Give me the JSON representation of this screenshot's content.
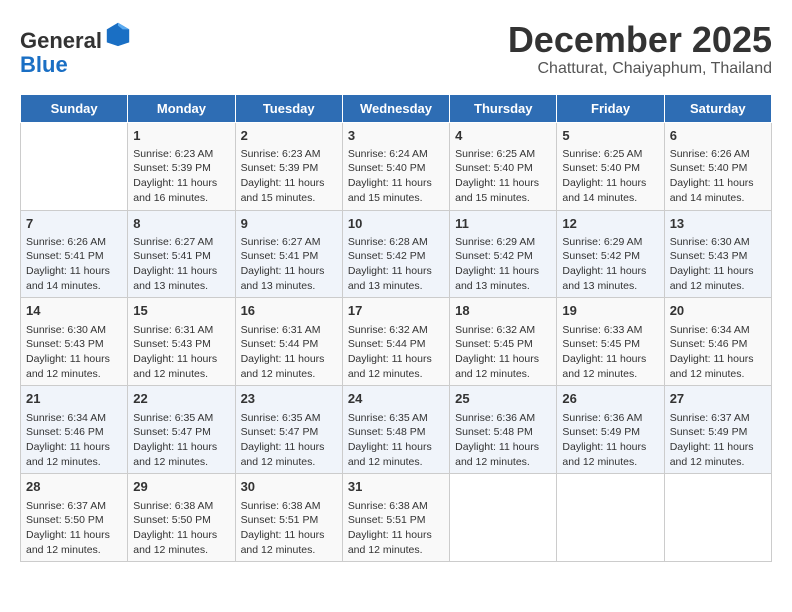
{
  "header": {
    "logo_line1": "General",
    "logo_line2": "Blue",
    "month": "December 2025",
    "location": "Chatturat, Chaiyaphum, Thailand"
  },
  "days_of_week": [
    "Sunday",
    "Monday",
    "Tuesday",
    "Wednesday",
    "Thursday",
    "Friday",
    "Saturday"
  ],
  "weeks": [
    [
      {
        "day": "",
        "info": ""
      },
      {
        "day": "1",
        "info": "Sunrise: 6:23 AM\nSunset: 5:39 PM\nDaylight: 11 hours\nand 16 minutes."
      },
      {
        "day": "2",
        "info": "Sunrise: 6:23 AM\nSunset: 5:39 PM\nDaylight: 11 hours\nand 15 minutes."
      },
      {
        "day": "3",
        "info": "Sunrise: 6:24 AM\nSunset: 5:40 PM\nDaylight: 11 hours\nand 15 minutes."
      },
      {
        "day": "4",
        "info": "Sunrise: 6:25 AM\nSunset: 5:40 PM\nDaylight: 11 hours\nand 15 minutes."
      },
      {
        "day": "5",
        "info": "Sunrise: 6:25 AM\nSunset: 5:40 PM\nDaylight: 11 hours\nand 14 minutes."
      },
      {
        "day": "6",
        "info": "Sunrise: 6:26 AM\nSunset: 5:40 PM\nDaylight: 11 hours\nand 14 minutes."
      }
    ],
    [
      {
        "day": "7",
        "info": "Sunrise: 6:26 AM\nSunset: 5:41 PM\nDaylight: 11 hours\nand 14 minutes."
      },
      {
        "day": "8",
        "info": "Sunrise: 6:27 AM\nSunset: 5:41 PM\nDaylight: 11 hours\nand 13 minutes."
      },
      {
        "day": "9",
        "info": "Sunrise: 6:27 AM\nSunset: 5:41 PM\nDaylight: 11 hours\nand 13 minutes."
      },
      {
        "day": "10",
        "info": "Sunrise: 6:28 AM\nSunset: 5:42 PM\nDaylight: 11 hours\nand 13 minutes."
      },
      {
        "day": "11",
        "info": "Sunrise: 6:29 AM\nSunset: 5:42 PM\nDaylight: 11 hours\nand 13 minutes."
      },
      {
        "day": "12",
        "info": "Sunrise: 6:29 AM\nSunset: 5:42 PM\nDaylight: 11 hours\nand 13 minutes."
      },
      {
        "day": "13",
        "info": "Sunrise: 6:30 AM\nSunset: 5:43 PM\nDaylight: 11 hours\nand 12 minutes."
      }
    ],
    [
      {
        "day": "14",
        "info": "Sunrise: 6:30 AM\nSunset: 5:43 PM\nDaylight: 11 hours\nand 12 minutes."
      },
      {
        "day": "15",
        "info": "Sunrise: 6:31 AM\nSunset: 5:43 PM\nDaylight: 11 hours\nand 12 minutes."
      },
      {
        "day": "16",
        "info": "Sunrise: 6:31 AM\nSunset: 5:44 PM\nDaylight: 11 hours\nand 12 minutes."
      },
      {
        "day": "17",
        "info": "Sunrise: 6:32 AM\nSunset: 5:44 PM\nDaylight: 11 hours\nand 12 minutes."
      },
      {
        "day": "18",
        "info": "Sunrise: 6:32 AM\nSunset: 5:45 PM\nDaylight: 11 hours\nand 12 minutes."
      },
      {
        "day": "19",
        "info": "Sunrise: 6:33 AM\nSunset: 5:45 PM\nDaylight: 11 hours\nand 12 minutes."
      },
      {
        "day": "20",
        "info": "Sunrise: 6:34 AM\nSunset: 5:46 PM\nDaylight: 11 hours\nand 12 minutes."
      }
    ],
    [
      {
        "day": "21",
        "info": "Sunrise: 6:34 AM\nSunset: 5:46 PM\nDaylight: 11 hours\nand 12 minutes."
      },
      {
        "day": "22",
        "info": "Sunrise: 6:35 AM\nSunset: 5:47 PM\nDaylight: 11 hours\nand 12 minutes."
      },
      {
        "day": "23",
        "info": "Sunrise: 6:35 AM\nSunset: 5:47 PM\nDaylight: 11 hours\nand 12 minutes."
      },
      {
        "day": "24",
        "info": "Sunrise: 6:35 AM\nSunset: 5:48 PM\nDaylight: 11 hours\nand 12 minutes."
      },
      {
        "day": "25",
        "info": "Sunrise: 6:36 AM\nSunset: 5:48 PM\nDaylight: 11 hours\nand 12 minutes."
      },
      {
        "day": "26",
        "info": "Sunrise: 6:36 AM\nSunset: 5:49 PM\nDaylight: 11 hours\nand 12 minutes."
      },
      {
        "day": "27",
        "info": "Sunrise: 6:37 AM\nSunset: 5:49 PM\nDaylight: 11 hours\nand 12 minutes."
      }
    ],
    [
      {
        "day": "28",
        "info": "Sunrise: 6:37 AM\nSunset: 5:50 PM\nDaylight: 11 hours\nand 12 minutes."
      },
      {
        "day": "29",
        "info": "Sunrise: 6:38 AM\nSunset: 5:50 PM\nDaylight: 11 hours\nand 12 minutes."
      },
      {
        "day": "30",
        "info": "Sunrise: 6:38 AM\nSunset: 5:51 PM\nDaylight: 11 hours\nand 12 minutes."
      },
      {
        "day": "31",
        "info": "Sunrise: 6:38 AM\nSunset: 5:51 PM\nDaylight: 11 hours\nand 12 minutes."
      },
      {
        "day": "",
        "info": ""
      },
      {
        "day": "",
        "info": ""
      },
      {
        "day": "",
        "info": ""
      }
    ]
  ]
}
